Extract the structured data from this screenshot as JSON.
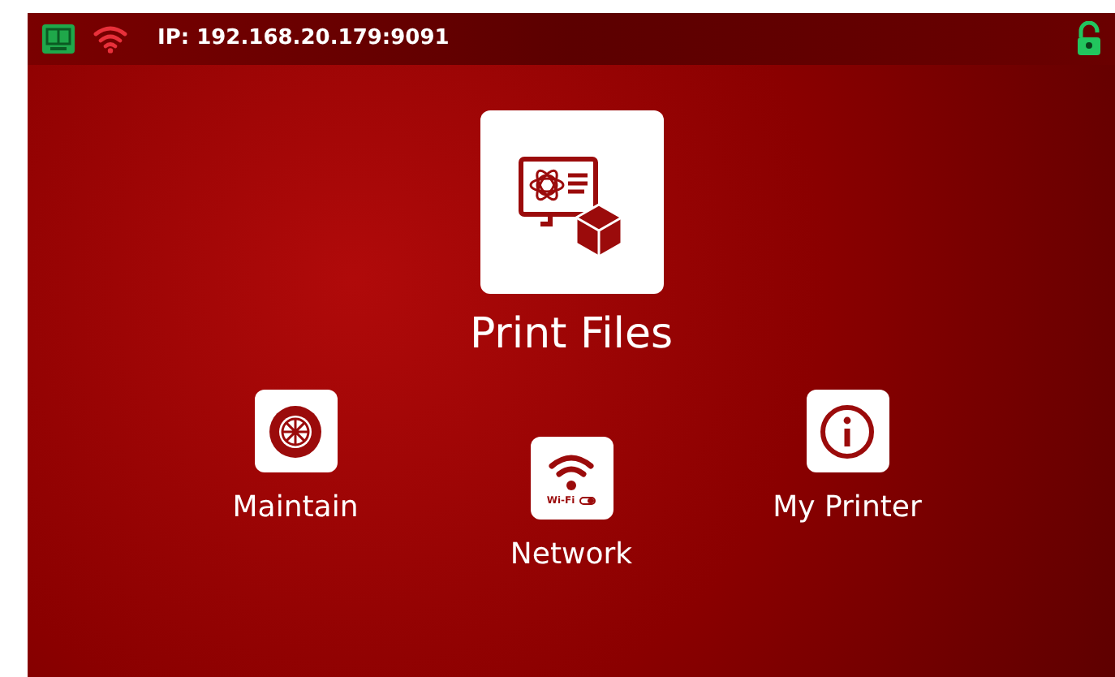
{
  "status_bar": {
    "ip": "IP: 192.168.20.179:9091",
    "wifi_connected": true,
    "locked": false
  },
  "main_item": {
    "kind": "files",
    "label": "Print Files"
  },
  "items": [
    {
      "kind": "maintain",
      "label": "Maintain"
    },
    {
      "kind": "network",
      "label": "Network",
      "badge": "Wi-Fi"
    },
    {
      "kind": "info",
      "label": "My Printer"
    }
  ]
}
